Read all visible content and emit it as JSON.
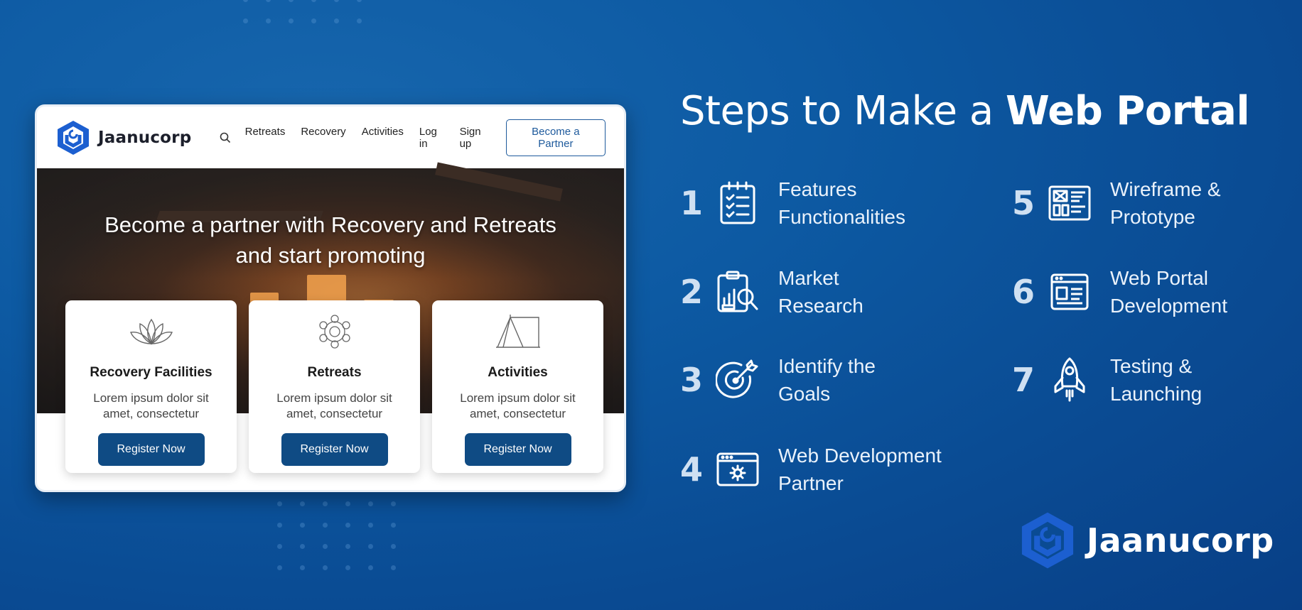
{
  "heading": {
    "normal": "Steps to Make a ",
    "bold": "Web Portal"
  },
  "mockup": {
    "logo_text": "Jaanucorp",
    "nav": [
      "Retreats",
      "Recovery",
      "Activities",
      "Log in",
      "Sign up"
    ],
    "partner_button": "Become a Partner",
    "hero_line1": "Become a partner with Recovery and Retreats",
    "hero_line2": "and start promoting",
    "cards": [
      {
        "title": "Recovery Facilities",
        "desc": "Lorem ipsum dolor sit amet, consectetur",
        "button": "Register Now",
        "icon": "lotus-icon"
      },
      {
        "title": "Retreats",
        "desc": "Lorem ipsum dolor sit amet, consectetur",
        "button": "Register Now",
        "icon": "floral-wreath-icon"
      },
      {
        "title": "Activities",
        "desc": "Lorem ipsum dolor sit amet, consectetur",
        "button": "Register Now",
        "icon": "tent-icon"
      }
    ]
  },
  "steps": [
    {
      "num": "1",
      "line1": "Features",
      "line2": "Functionalities",
      "icon": "checklist-icon"
    },
    {
      "num": "2",
      "line1": "Market",
      "line2": "Research",
      "icon": "research-report-icon"
    },
    {
      "num": "3",
      "line1": "Identify the",
      "line2": "Goals",
      "icon": "target-icon"
    },
    {
      "num": "4",
      "line1": "Web Development",
      "line2": "Partner",
      "icon": "browser-gear-icon"
    },
    {
      "num": "5",
      "line1": "Wireframe &",
      "line2": "Prototype",
      "icon": "wireframe-icon"
    },
    {
      "num": "6",
      "line1": "Web Portal",
      "line2": "Development",
      "icon": "web-layout-icon"
    },
    {
      "num": "7",
      "line1": "Testing &",
      "line2": "Launching",
      "icon": "rocket-icon"
    }
  ],
  "brand": {
    "name": "Jaanucorp"
  },
  "colors": {
    "background": "#0b4f98",
    "button": "#0f4b84",
    "accent": "#1e5a9c",
    "logo_blue": "#1c5fd0"
  }
}
